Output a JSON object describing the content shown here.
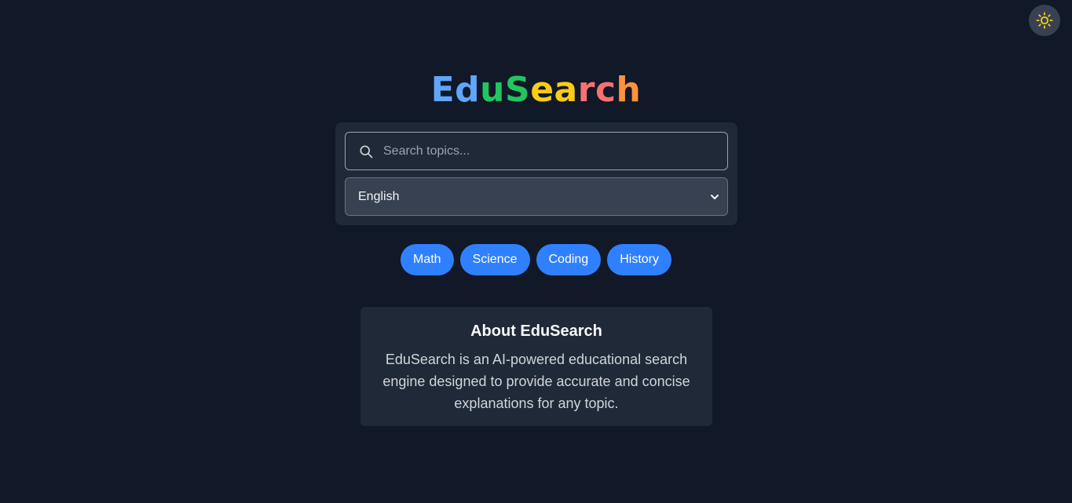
{
  "theme_toggle": {
    "icon": "sun-icon",
    "color": "#facc15"
  },
  "logo": {
    "letters": [
      {
        "char": "E",
        "color": "#60a5fa"
      },
      {
        "char": "d",
        "color": "#60a5fa"
      },
      {
        "char": "u",
        "color": "#22c55e"
      },
      {
        "char": "S",
        "color": "#22c55e"
      },
      {
        "char": "e",
        "color": "#facc15"
      },
      {
        "char": "a",
        "color": "#facc15"
      },
      {
        "char": "r",
        "color": "#f87171"
      },
      {
        "char": "c",
        "color": "#f87171"
      },
      {
        "char": "h",
        "color": "#fb923c"
      }
    ]
  },
  "search": {
    "placeholder": "Search topics...",
    "value": "",
    "icon": "search-icon"
  },
  "language": {
    "selected": "English",
    "icon": "chevron-down-icon"
  },
  "categories": [
    "Math",
    "Science",
    "Coding",
    "History"
  ],
  "about": {
    "title": "About EduSearch",
    "body": "EduSearch is an AI-powered educational search engine designed to provide accurate and concise explanations for any topic."
  },
  "colors": {
    "background": "#111827",
    "card": "#1f2937",
    "chip": "#2f80ff"
  }
}
